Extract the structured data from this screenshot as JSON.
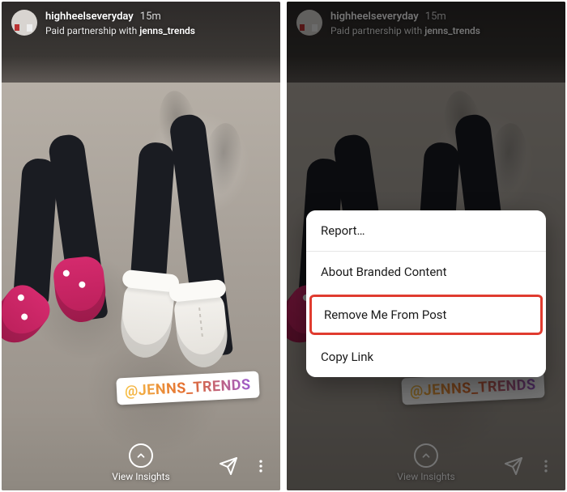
{
  "left": {
    "header": {
      "username": "highheelseveryday",
      "timestamp": "15m",
      "partnership_prefix": "Paid partnership with ",
      "partnership_partner": "jenns_trends"
    },
    "mention_sticker": "@JENNS_TRENDS",
    "footer": {
      "insights_label": "View Insights"
    }
  },
  "right": {
    "header": {
      "username": "highheelseveryday",
      "timestamp": "15m",
      "partnership_prefix": "Paid partnership with ",
      "partnership_partner": "jenns_trends"
    },
    "mention_sticker": "@JENNS_TRENDS",
    "footer": {
      "insights_label": "View Insights"
    },
    "action_sheet": {
      "items": [
        {
          "label": "Report…",
          "highlighted": false
        },
        {
          "label": "About Branded Content",
          "highlighted": false
        },
        {
          "label": "Remove Me From Post",
          "highlighted": true
        },
        {
          "label": "Copy Link",
          "highlighted": false
        }
      ]
    }
  },
  "icons": {
    "chevron_up": "chevron-up-icon",
    "share": "paper-plane-icon",
    "more": "more-vertical-icon"
  }
}
